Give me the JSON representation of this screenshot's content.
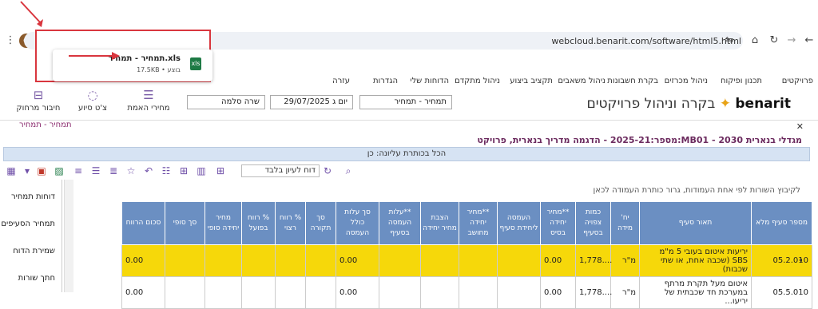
{
  "browser": {
    "url": "webcloud.benarit.com/software/html5.html",
    "download": {
      "file_name": "תמחיר - תמחיר.xls",
      "file_meta": "17.5KB • בוצע",
      "file_ext": "xls"
    }
  },
  "app": {
    "logo_text": "בקרה וניהול פרויקטים",
    "logo_brand": "benarit",
    "menu": [
      "פרויקטים",
      "תכנון ופיקוח",
      "ניהול מכרזים",
      "בקרת חשבונות",
      "ניהול משאבים",
      "תקציב ביצוע",
      "ניהול מתקדם",
      "הדוחות שלי",
      "הגדרות",
      "עזרה"
    ],
    "selects": {
      "costing": "תמחיר - תמחיר",
      "date": "יום ג 29/07/2025",
      "user": "שרה סלמה"
    },
    "tools": [
      {
        "label": "מחירי האמת",
        "icon": "price-list-icon"
      },
      {
        "label": "צ'ט סיוע",
        "icon": "chat-icon"
      },
      {
        "label": "חיבור מרחוק",
        "icon": "remote-icon"
      }
    ],
    "tab_label": "תמחיר - תמחיר",
    "project_line": "מספר:2025-21 - הדגמה מדריך בנארית,   פרויקט:MB01 - מגדלי בנארית 2030",
    "header_bar": "הכל בכותרת עליונה: כן",
    "view_select": "דוח לעיון בלבד",
    "side_items": [
      "דוחות תמחיר",
      "תמחיר הסעיפים",
      "שמירת הדוח",
      "חתך שורות"
    ],
    "table_hint": "לקיבוץ השורות לפי אחת העמודות, גרור כותרת העמודה לכאן",
    "columns": [
      "מספר סעיף מלא",
      "תאור סעיף",
      "יח' מידה",
      "כמות צפויה בסעיף",
      "**מחיר יחידה בסיס",
      "העמסה ליחידת סעיף",
      "**מחיר יחידה מחושב",
      "הצבת מחיר יחידה",
      "**עלות העמסה בסעיף",
      "סך עלות כולל העמסה",
      "סך תקורה",
      "% רווח רצוי",
      "% רווח בפועל",
      "מחיר יחידה סופי",
      "סך סופי",
      "סכום הרווח"
    ],
    "rows": [
      {
        "num": "05.2.010",
        "desc": "יריעות איטום בעובי 5 מ\"מ SBS (שכבה אחת, או שתי שכבות)",
        "unit": "מ\"ר",
        "qty": "1,778....",
        "base": "0.00",
        "total": "0.00",
        "profit": "0.00",
        "highlight": true
      },
      {
        "num": "05.5.010",
        "desc": "איטום מעל תקרת מרתף במערכת חד שכבתית של יריעו...",
        "unit": "מ\"ר",
        "qty": "1,778....",
        "base": "0.00",
        "total": "0.00",
        "profit": "0.00",
        "highlight": false
      }
    ]
  }
}
